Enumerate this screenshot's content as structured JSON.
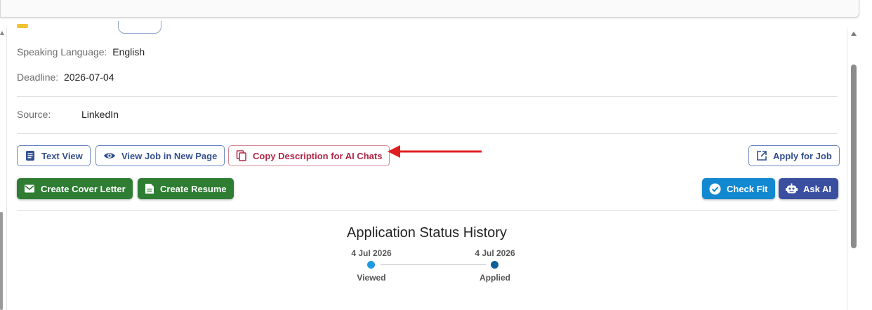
{
  "details": {
    "speaking_language_label": "Speaking Language:",
    "speaking_language_value": "English",
    "deadline_label": "Deadline:",
    "deadline_value": "2026-07-04",
    "source_label": "Source:",
    "source_value": "LinkedIn"
  },
  "actions": {
    "text_view": "Text View",
    "view_job_new_page": "View Job in New Page",
    "copy_description": "Copy Description for AI Chats",
    "apply_for_job": "Apply for Job",
    "create_cover_letter": "Create Cover Letter",
    "create_resume": "Create Resume",
    "check_fit": "Check Fit",
    "ask_ai": "Ask AI"
  },
  "status_history": {
    "title": "Application Status History",
    "events": [
      {
        "date": "4 Jul 2026",
        "label": "Viewed",
        "color": "#1e9be0"
      },
      {
        "date": "4 Jul 2026",
        "label": "Applied",
        "color": "#0d5f99"
      }
    ]
  },
  "colors": {
    "outline_blue": "#34508f",
    "outline_red": "#b02848",
    "green": "#2e7d32",
    "cyan": "#1188d0",
    "navy": "#3a4fa0",
    "annotation_arrow": "#e02020"
  },
  "icons": {
    "text_view": "article-icon",
    "view_job": "eye-icon",
    "copy": "copy-icon",
    "apply": "open-in-new-icon",
    "cover_letter": "mail-icon",
    "resume": "document-icon",
    "check_fit": "check-circle-icon",
    "ask_ai": "robot-icon"
  }
}
